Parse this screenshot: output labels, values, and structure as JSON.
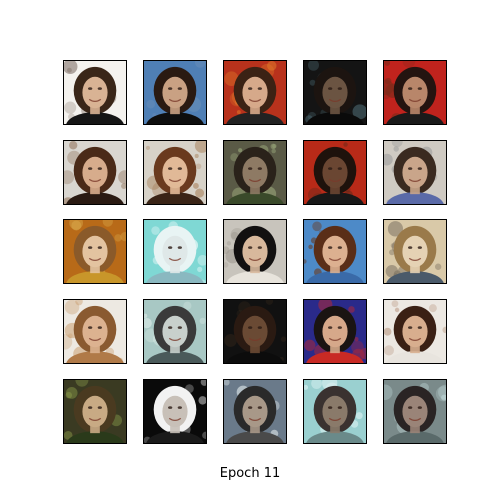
{
  "figure": {
    "caption": "Epoch 11"
  },
  "grid": {
    "rows": 5,
    "cols": 5,
    "tiles": [
      {
        "bg": "#f4f2ee",
        "hair": "#3a2618",
        "skin": "#d9b394",
        "shirt": "#151515",
        "noise": "#7a6a60"
      },
      {
        "bg": "#4f7fb5",
        "hair": "#2a1a12",
        "skin": "#c9a183",
        "shirt": "#0e0e0e",
        "noise": "#6b8fb8"
      },
      {
        "bg": "#b8321c",
        "hair": "#3b2214",
        "skin": "#d6a98a",
        "shirt": "#222222",
        "noise": "#e07a2a"
      },
      {
        "bg": "#141414",
        "hair": "#1c1410",
        "skin": "#6b5442",
        "shirt": "#0a0a0a",
        "noise": "#4c6a72"
      },
      {
        "bg": "#c0231d",
        "hair": "#241410",
        "skin": "#b8866a",
        "shirt": "#1a1a1a",
        "noise": "#7a2b1a"
      },
      {
        "bg": "#d9d6d0",
        "hair": "#4a2a18",
        "skin": "#d7ac8c",
        "shirt": "#2a1a12",
        "noise": "#8a6a50"
      },
      {
        "bg": "#d7d2c8",
        "hair": "#6a3a1e",
        "skin": "#e1b997",
        "shirt": "#3a2416",
        "noise": "#a47a52"
      },
      {
        "bg": "#5a5a46",
        "hair": "#2a221a",
        "skin": "#8e7a64",
        "shirt": "#3a4a2a",
        "noise": "#a0b080"
      },
      {
        "bg": "#b82a18",
        "hair": "#1e120c",
        "skin": "#6a4632",
        "shirt": "#181818",
        "noise": "#4a2a1a"
      },
      {
        "bg": "#cfcac2",
        "hair": "#3a2a20",
        "skin": "#c9a58a",
        "shirt": "#5a6aa8",
        "noise": "#9a9a9a"
      },
      {
        "bg": "#b86a18",
        "hair": "#8a5a2a",
        "skin": "#e3c3a0",
        "shirt": "#c8962a",
        "noise": "#d8a84a"
      },
      {
        "bg": "#7fd8d4",
        "hair": "#e8f4f4",
        "skin": "#dfe8e8",
        "shirt": "#8ab8c0",
        "noise": "#ffffff"
      },
      {
        "bg": "#c8c4bc",
        "hair": "#121010",
        "skin": "#d8b89c",
        "shirt": "#e8e4dc",
        "noise": "#9a948c"
      },
      {
        "bg": "#4d8ac8",
        "hair": "#5a2e18",
        "skin": "#dcb090",
        "shirt": "#3a6aa8",
        "noise": "#6a3a20"
      },
      {
        "bg": "#d9c9a8",
        "hair": "#9a7a4a",
        "skin": "#e5d2b4",
        "shirt": "#4a5a6a",
        "noise": "#7a7060"
      },
      {
        "bg": "#ede9e2",
        "hair": "#8a5a30",
        "skin": "#dcb290",
        "shirt": "#b07a48",
        "noise": "#c89a6a"
      },
      {
        "bg": "#a8c8c4",
        "hair": "#3a3a3a",
        "skin": "#c8d0cc",
        "shirt": "#4a5a5a",
        "noise": "#e4f0ec"
      },
      {
        "bg": "#111111",
        "hair": "#2a1a12",
        "skin": "#6a4a34",
        "shirt": "#0c0c0c",
        "noise": "#3a2a1c"
      },
      {
        "bg": "#2a2a8a",
        "hair": "#1a1412",
        "skin": "#d6a88a",
        "shirt": "#c82a24",
        "noise": "#a8283a"
      },
      {
        "bg": "#ece8e2",
        "hair": "#3a2014",
        "skin": "#d8ae8e",
        "shirt": "#e8e4de",
        "noise": "#b89680"
      },
      {
        "bg": "#3a3a22",
        "hair": "#4a3a20",
        "skin": "#c8aa84",
        "shirt": "#2a3a1a",
        "noise": "#8a9a4a"
      },
      {
        "bg": "#0a0a0a",
        "hair": "#f2f2f2",
        "skin": "#c8c0b8",
        "shirt": "#1a1a1a",
        "noise": "#ffffff"
      },
      {
        "bg": "#6a7a8a",
        "hair": "#2a2a2a",
        "skin": "#a89888",
        "shirt": "#4a4a4a",
        "noise": "#e8f0f0"
      },
      {
        "bg": "#9ad0d0",
        "hair": "#3a3230",
        "skin": "#8a7a6a",
        "shirt": "#6a8a8a",
        "noise": "#e8f8f8"
      },
      {
        "bg": "#7a8a8a",
        "hair": "#2a2424",
        "skin": "#9a8478",
        "shirt": "#5a6a6a",
        "noise": "#c8e0e0"
      }
    ]
  }
}
